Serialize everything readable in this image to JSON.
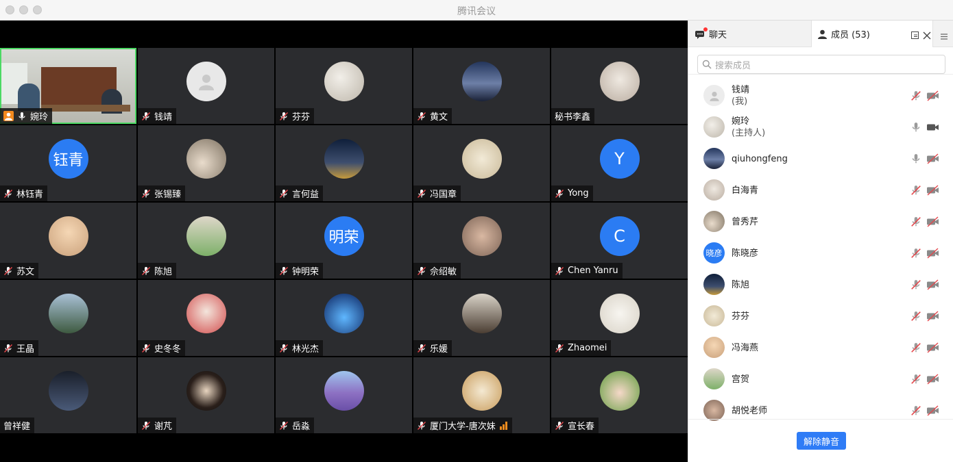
{
  "window": {
    "title": "腾讯会议"
  },
  "video_tiles": [
    {
      "name": "婉玲",
      "avatar": "photo",
      "self": true
    },
    {
      "name": "钱靖",
      "avatar": "default"
    },
    {
      "name": "芬芬",
      "avatar": "photo"
    },
    {
      "name": "黄文",
      "avatar": "photo"
    },
    {
      "name": "秘书李鑫",
      "avatar": "photo",
      "no_mic": true
    },
    {
      "name": "林钰青",
      "avatar": "text",
      "avatar_text": "钰青"
    },
    {
      "name": "张锡臻",
      "avatar": "photo"
    },
    {
      "name": "言何益",
      "avatar": "photo"
    },
    {
      "name": "冯国章",
      "avatar": "photo"
    },
    {
      "name": "Yong",
      "avatar": "text",
      "avatar_text": "Y"
    },
    {
      "name": "苏文",
      "avatar": "photo"
    },
    {
      "name": "陈旭",
      "avatar": "photo"
    },
    {
      "name": "钟明荣",
      "avatar": "text",
      "avatar_text": "明荣"
    },
    {
      "name": "佘绍敏",
      "avatar": "photo"
    },
    {
      "name": "Chen Yanru",
      "avatar": "text",
      "avatar_text": "C"
    },
    {
      "name": "王晶",
      "avatar": "photo"
    },
    {
      "name": "史冬冬",
      "avatar": "photo"
    },
    {
      "name": "林光杰",
      "avatar": "photo"
    },
    {
      "name": "乐媛",
      "avatar": "photo"
    },
    {
      "name": "Zhaomei",
      "avatar": "photo"
    },
    {
      "name": "曾祥健",
      "avatar": "photo",
      "no_mic": true
    },
    {
      "name": "谢芃",
      "avatar": "photo"
    },
    {
      "name": "岳淼",
      "avatar": "photo"
    },
    {
      "name": "厦门大学-唐次妹",
      "avatar": "photo",
      "signal": true
    },
    {
      "name": "宣长春",
      "avatar": "photo"
    }
  ],
  "panel": {
    "tabs": {
      "chat": "聊天",
      "members": "成员 (53)"
    },
    "search_placeholder": "搜索成员",
    "members": [
      {
        "name": "钱靖",
        "sub": "(我)",
        "avatar": "default",
        "mic": "muted",
        "cam": "off"
      },
      {
        "name": "婉玲",
        "sub": "(主持人)",
        "avatar": "photo",
        "mic": "on",
        "cam": "on"
      },
      {
        "name": "qiuhongfeng",
        "avatar": "photo",
        "mic": "on",
        "cam": "off"
      },
      {
        "name": "白海青",
        "avatar": "photo",
        "mic": "muted",
        "cam": "off"
      },
      {
        "name": "曾秀芹",
        "avatar": "photo",
        "mic": "muted",
        "cam": "off"
      },
      {
        "name": "陈晓彦",
        "avatar": "text",
        "avatar_text": "晓彦",
        "mic": "muted",
        "cam": "off"
      },
      {
        "name": "陈旭",
        "avatar": "photo",
        "mic": "muted",
        "cam": "off"
      },
      {
        "name": "芬芬",
        "avatar": "photo",
        "mic": "muted",
        "cam": "off"
      },
      {
        "name": "冯海燕",
        "avatar": "photo",
        "mic": "muted",
        "cam": "off"
      },
      {
        "name": "宫贺",
        "avatar": "photo",
        "mic": "muted",
        "cam": "off"
      },
      {
        "name": "胡悦老师",
        "avatar": "photo",
        "mic": "muted",
        "cam": "off"
      }
    ],
    "unmute_label": "解除静音"
  },
  "colors": {
    "accent": "#2f7cf6",
    "active_speaker": "#4cd964",
    "tile_bg": "#2b2c2f"
  }
}
